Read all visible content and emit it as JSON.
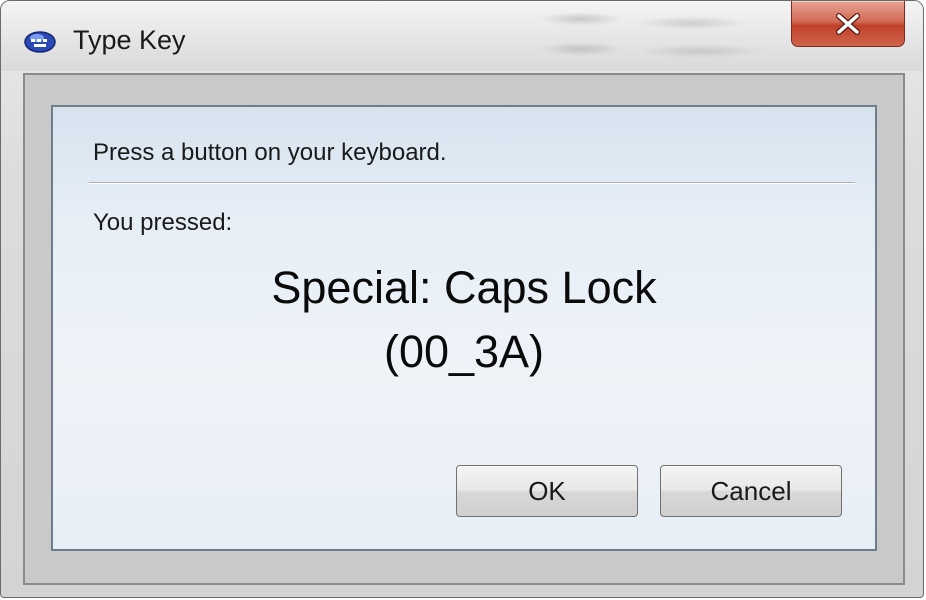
{
  "window": {
    "title": "Type Key",
    "icon": "keyboard-app-icon",
    "close_icon": "close-icon"
  },
  "dialog": {
    "instruction": "Press a button on your keyboard.",
    "pressed_label": "You pressed:",
    "key_name": "Special: Caps Lock",
    "key_code": "(00_3A)"
  },
  "buttons": {
    "ok_label": "OK",
    "cancel_label": "Cancel"
  },
  "colors": {
    "close_button": "#c94a34",
    "client_background": "#e6eef6"
  }
}
